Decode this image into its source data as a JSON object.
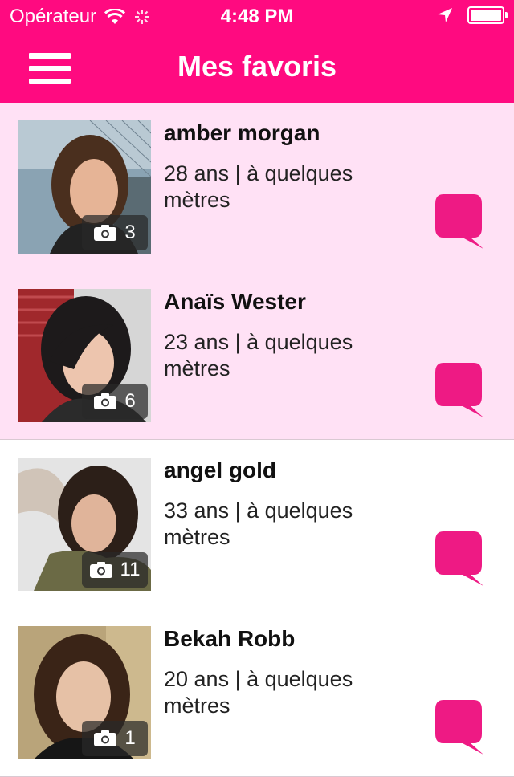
{
  "status_bar": {
    "carrier": "Opérateur",
    "time": "4:48 PM"
  },
  "nav": {
    "title": "Mes favoris"
  },
  "colors": {
    "brand": "#ff0a80",
    "row_highlight": "#ffe1f5",
    "chat_bubble": "#ee1a84"
  },
  "profiles": [
    {
      "name": "amber morgan",
      "details": "28 ans | à quelques mètres",
      "photo_count": "3",
      "highlighted": true
    },
    {
      "name": "Anaïs Wester",
      "details": "23 ans | à quelques mètres",
      "photo_count": "6",
      "highlighted": true
    },
    {
      "name": "angel gold",
      "details": "33 ans | à quelques mètres",
      "photo_count": "11",
      "highlighted": false
    },
    {
      "name": "Bekah Robb",
      "details": "20 ans | à quelques mètres",
      "photo_count": "1",
      "highlighted": false
    }
  ]
}
